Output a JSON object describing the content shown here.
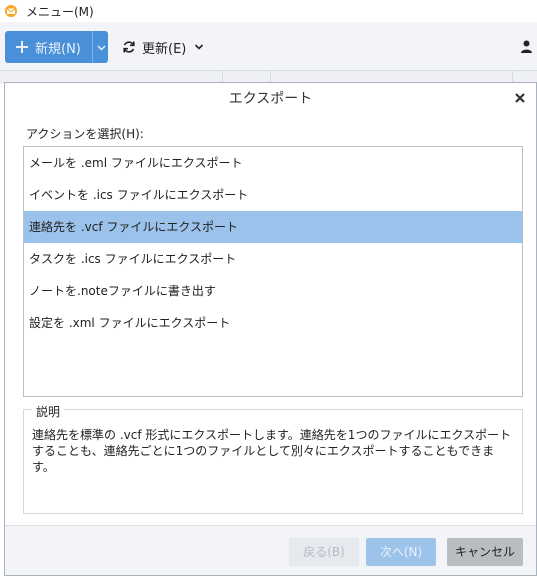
{
  "app": {
    "menu_label": "メニュー(M)",
    "new_button_label": "新規(N)",
    "refresh_button_label": "更新(E)",
    "colors": {
      "accent": "#4a90d9",
      "selection": "#9ac2ea"
    }
  },
  "dialog": {
    "title": "エクスポート",
    "action_label": "アクションを選択(H):",
    "actions": [
      {
        "label": "メールを .eml ファイルにエクスポート",
        "selected": false
      },
      {
        "label": "イベントを .ics ファイルにエクスポート",
        "selected": false
      },
      {
        "label": "連絡先を .vcf ファイルにエクスポート",
        "selected": true
      },
      {
        "label": "タスクを .ics ファイルにエクスポート",
        "selected": false
      },
      {
        "label": "ノートを.noteファイルに書き出す",
        "selected": false
      },
      {
        "label": "設定を .xml ファイルにエクスポート",
        "selected": false
      }
    ],
    "description_title": "説明",
    "description_text": "連絡先を標準の .vcf 形式にエクスポートします。連絡先を1つのファイルにエクスポートすることも、連絡先ごとに1つのファイルとして別々にエクスポートすることもできます。",
    "buttons": {
      "back": "戻る(B)",
      "next": "次へ(N)",
      "cancel": "キャンセル"
    }
  }
}
